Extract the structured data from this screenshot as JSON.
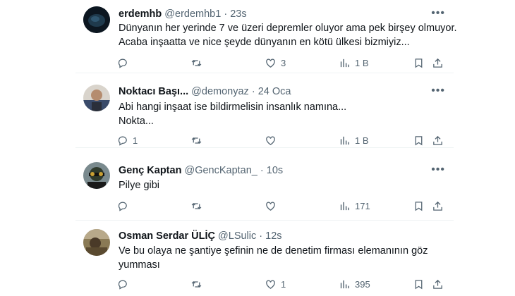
{
  "tweets": [
    {
      "name": "erdemhb",
      "handle": "@erdemhb1",
      "time": "23s",
      "lines": [
        "Dünyanın her yerinde 7 ve üzeri depremler oluyor ama pek birşey olmuyor.",
        "Acaba inşaatta ve nice şeyde dünyanın en kötü ülkesi bizmiyiz..."
      ],
      "counts": {
        "reply": "",
        "retweet": "",
        "like": "3",
        "views": "1 B"
      },
      "avatar_color": "#12212e"
    },
    {
      "name": "Noktacı Başı...",
      "handle": "@demonyaz",
      "time": "24 Oca",
      "lines": [
        "Abi hangi inşaat ise bildirmelisin insanlık namına...",
        "Nokta..."
      ],
      "counts": {
        "reply": "1",
        "retweet": "",
        "like": "",
        "views": "1 B"
      },
      "avatar_color": "#3a3f4a"
    },
    {
      "name": "Genç Kaptan",
      "handle": "@GencKaptan_",
      "time": "10s",
      "lines": [
        "Pilye gibi"
      ],
      "counts": {
        "reply": "",
        "retweet": "",
        "like": "",
        "views": "171"
      },
      "avatar_color": "#4a5a4a"
    },
    {
      "name": "Osman Serdar ÜLİÇ",
      "handle": "@LSulic",
      "time": "12s",
      "lines": [
        "Ve bu olaya ne şantiye şefinin ne de denetim firması elemanının göz",
        "yumması"
      ],
      "counts": {
        "reply": "",
        "retweet": "",
        "like": "1",
        "views": "395"
      },
      "avatar_color": "#6b5a3a"
    }
  ],
  "separator": "·",
  "more_icon": "•••",
  "colors": {
    "text": "#0f1419",
    "secondary": "#536471",
    "border": "#eff3f4"
  },
  "icons": [
    "reply-icon",
    "retweet-icon",
    "like-icon",
    "views-icon",
    "bookmark-icon",
    "share-icon"
  ]
}
